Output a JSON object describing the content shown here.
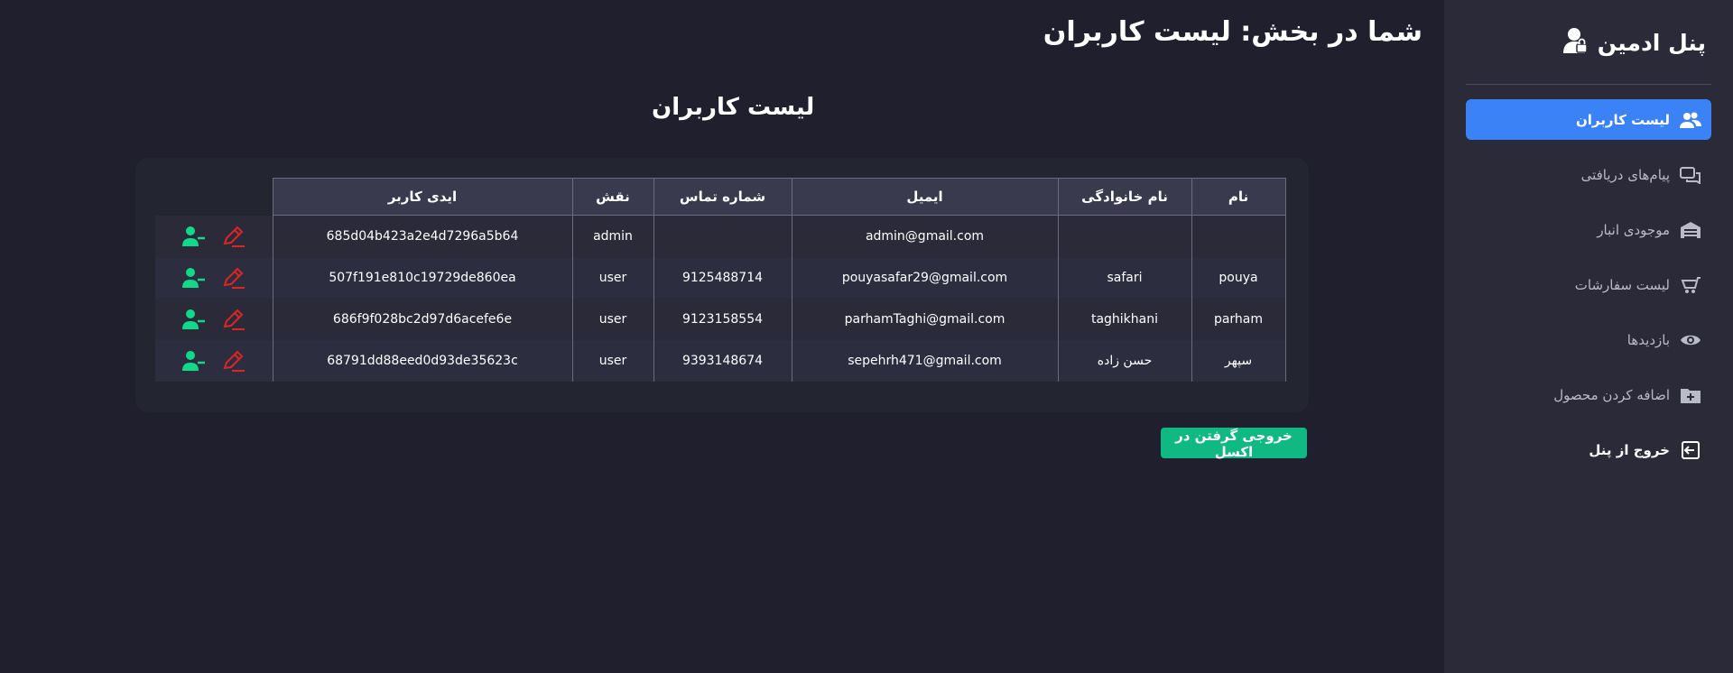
{
  "sidebar": {
    "title": "پنل ادمین",
    "items": [
      {
        "label": "لیست کاربران",
        "icon": "users-icon",
        "active": true
      },
      {
        "label": "پیام‌های دریافتی",
        "icon": "messages-icon",
        "active": false
      },
      {
        "label": "موجودی انبار",
        "icon": "warehouse-icon",
        "active": false
      },
      {
        "label": "لیست سفارشات",
        "icon": "cart-icon",
        "active": false
      },
      {
        "label": "بازدیدها",
        "icon": "eye-icon",
        "active": false
      },
      {
        "label": "اضافه کردن محصول",
        "icon": "folder-plus-icon",
        "active": false
      }
    ],
    "logout_label": "خروج از پنل"
  },
  "header": {
    "page_title": "شما در بخش: لیست کاربران"
  },
  "main": {
    "section_title": "لیست کاربران",
    "export_label": "خروجی گرفتن در اکسل"
  },
  "table": {
    "headers": [
      "نام",
      "نام خانوادگی",
      "ایمیل",
      "شماره تماس",
      "نقش",
      "ایدی کاربر"
    ],
    "rows": [
      {
        "first": "",
        "last": "",
        "email": "admin@gmail.com",
        "phone": "",
        "role": "admin",
        "id": "685d04b423a2e4d7296a5b64"
      },
      {
        "first": "pouya",
        "last": "safari",
        "email": "pouyasafar29@gmail.com",
        "phone": "9125488714",
        "role": "user",
        "id": "507f191e810c19729de860ea"
      },
      {
        "first": "parham",
        "last": "taghikhani",
        "email": "parhamTaghi@gmail.com",
        "phone": "9123158554",
        "role": "user",
        "id": "686f9f028bc2d97d6acefe6e"
      },
      {
        "first": "سپهر",
        "last": "حسن زاده",
        "email": "sepehrh471@gmail.com",
        "phone": "9393148674",
        "role": "user",
        "id": "68791dd88eed0d93de35623c"
      }
    ]
  },
  "colors": {
    "accent": "#3b82f6",
    "export": "#10b981",
    "edit_icon": "#dc2626",
    "remove_user_icon": "#10d98a"
  }
}
